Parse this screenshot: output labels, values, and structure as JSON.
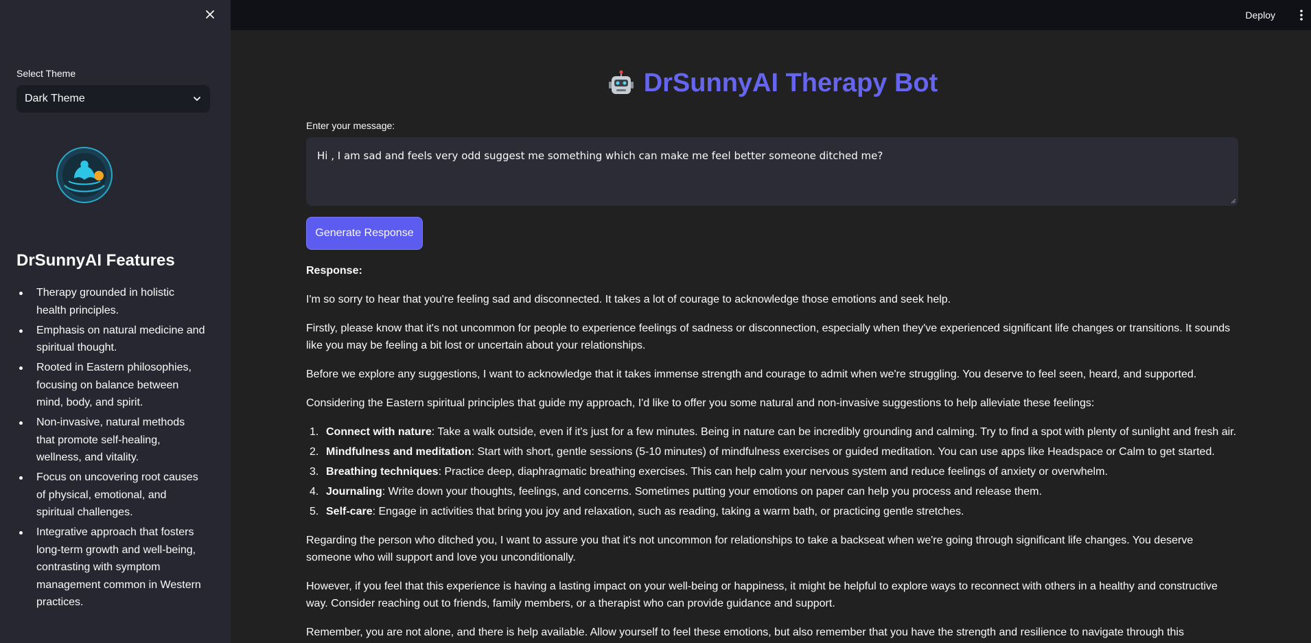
{
  "sidebar": {
    "close_icon": "close-icon",
    "theme_label": "Select Theme",
    "theme_value": "Dark Theme",
    "features_title": "DrSunnyAI Features",
    "features": [
      "Therapy grounded in holistic health principles.",
      "Emphasis on natural medicine and spiritual thought.",
      "Rooted in Eastern philosophies, focusing on balance between mind, body, and spirit.",
      "Non-invasive, natural methods that promote self-healing, wellness, and vitality.",
      "Focus on uncovering root causes of physical, emotional, and spiritual challenges.",
      "Integrative approach that fosters long-term growth and well-being, contrasting with symptom management common in Western practices."
    ]
  },
  "topbar": {
    "deploy_label": "Deploy"
  },
  "main": {
    "title": "DrSunnyAI Therapy Bot",
    "input_label": "Enter your message:",
    "message_value": "Hi , I am sad and feels very odd suggest me something which can make me feel better someone ditched me?",
    "generate_label": "Generate Response",
    "response_label": "Response:",
    "paragraphs_before": [
      "I'm so sorry to hear that you're feeling sad and disconnected. It takes a lot of courage to acknowledge those emotions and seek help.",
      "Firstly, please know that it's not uncommon for people to experience feelings of sadness or disconnection, especially when they've experienced significant life changes or transitions. It sounds like you may be feeling a bit lost or uncertain about your relationships.",
      "Before we explore any suggestions, I want to acknowledge that it takes immense strength and courage to admit when we're struggling. You deserve to feel seen, heard, and supported.",
      "Considering the Eastern spiritual principles that guide my approach, I'd like to offer you some natural and non-invasive suggestions to help alleviate these feelings:"
    ],
    "suggestions": [
      {
        "num": "1.",
        "title": "Connect with nature",
        "text": ": Take a walk outside, even if it's just for a few minutes. Being in nature can be incredibly grounding and calming. Try to find a spot with plenty of sunlight and fresh air."
      },
      {
        "num": "2.",
        "title": "Mindfulness and meditation",
        "text": ": Start with short, gentle sessions (5-10 minutes) of mindfulness exercises or guided meditation. You can use apps like Headspace or Calm to get started."
      },
      {
        "num": "3.",
        "title": "Breathing techniques",
        "text": ": Practice deep, diaphragmatic breathing exercises. This can help calm your nervous system and reduce feelings of anxiety or overwhelm."
      },
      {
        "num": "4.",
        "title": "Journaling",
        "text": ": Write down your thoughts, feelings, and concerns. Sometimes putting your emotions on paper can help you process and release them."
      },
      {
        "num": "5.",
        "title": "Self-care",
        "text": ": Engage in activities that bring you joy and relaxation, such as reading, taking a warm bath, or practicing gentle stretches."
      }
    ],
    "paragraphs_after": [
      "Regarding the person who ditched you, I want to assure you that it's not uncommon for relationships to take a backseat when we're going through significant life changes. You deserve someone who will support and love you unconditionally.",
      "However, if you feel that this experience is having a lasting impact on your well-being or happiness, it might be helpful to explore ways to reconnect with others in a healthy and constructive way. Consider reaching out to friends, family members, or a therapist who can provide guidance and support.",
      "Remember, you are not alone, and there is help available. Allow yourself to feel these emotions, but also remember that you have the strength and resilience to navigate through this challenging time."
    ]
  },
  "colors": {
    "accent": "#6565ef",
    "button": "#5c5cf0",
    "sidebar_bg": "#262730",
    "main_bg": "#212121"
  }
}
